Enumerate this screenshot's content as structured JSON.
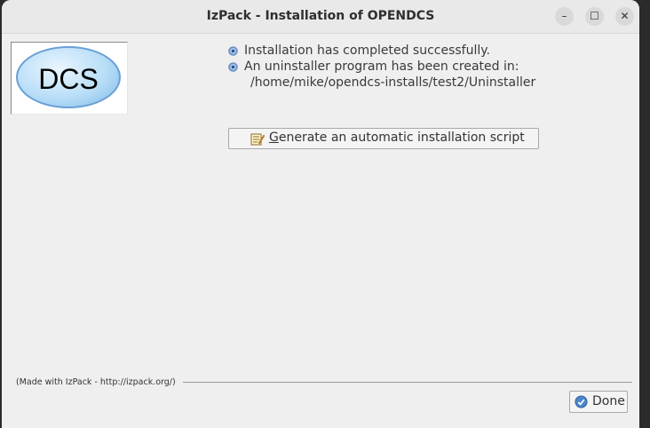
{
  "window": {
    "title": "IzPack - Installation of OPENDCS",
    "controls": {
      "minimize": "–",
      "maximize": "☐",
      "close": "✕"
    }
  },
  "logo": {
    "text": "DCS"
  },
  "messages": [
    {
      "icon": "gear-icon",
      "text": "Installation has completed successfully."
    },
    {
      "icon": "gear-icon",
      "text": "An uninstaller program has been created in:"
    }
  ],
  "uninstaller_path": "/home/mike/opendcs-installs/test2/Uninstaller",
  "script_button": {
    "first_letter": "G",
    "rest": "enerate an automatic installation script",
    "icon": "notepad-pencil-icon"
  },
  "footer": {
    "made_with": "(Made with IzPack - http://izpack.org/)"
  },
  "done_button": {
    "label": "Done",
    "icon": "checkmark-icon"
  },
  "colors": {
    "accent": "#4a86c8",
    "window_bg": "#efefef",
    "titlebar_bg": "#e9e9e9"
  }
}
